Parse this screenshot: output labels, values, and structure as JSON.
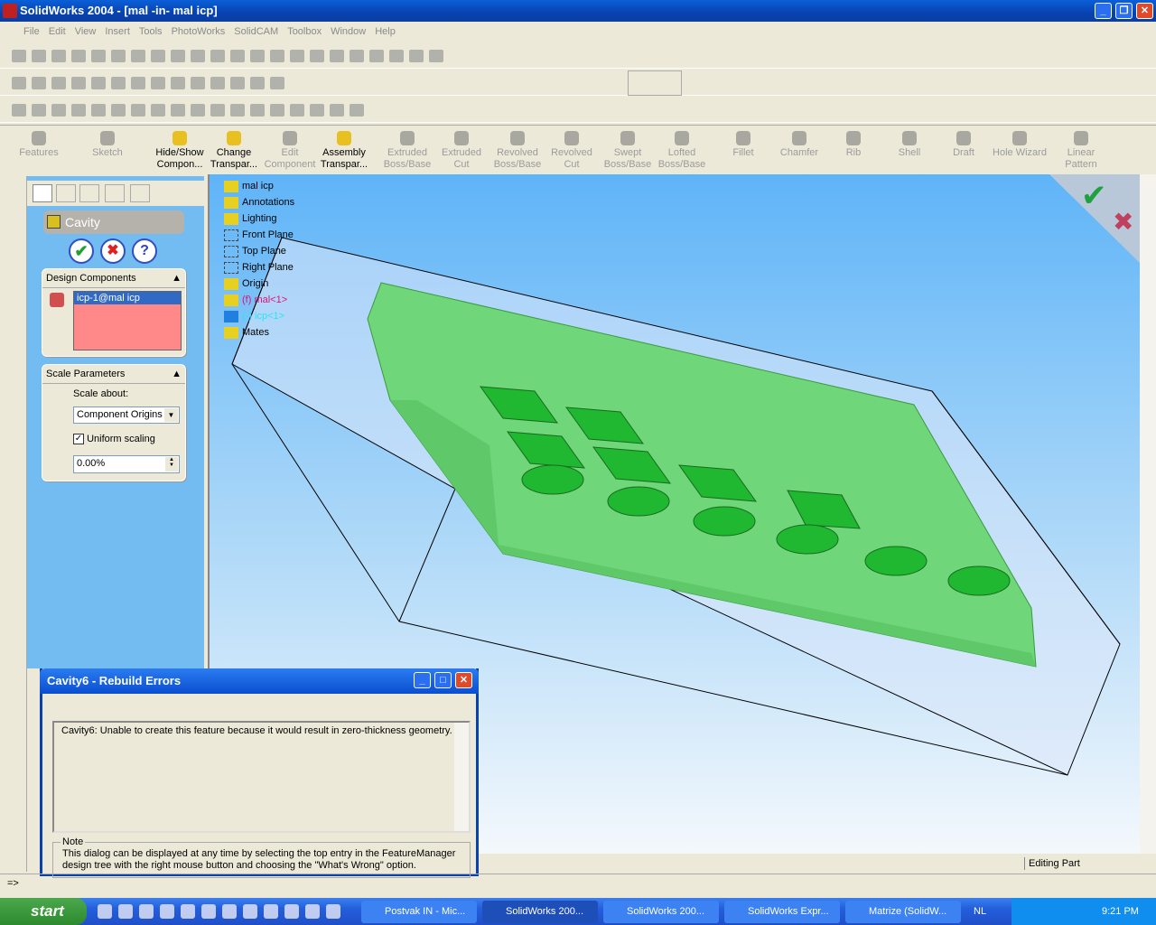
{
  "window": {
    "title": "SolidWorks 2004 - [mal -in- mal icp]"
  },
  "menu": [
    "File",
    "Edit",
    "View",
    "Insert",
    "Tools",
    "PhotoWorks",
    "SolidCAM",
    "Toolbox",
    "Window",
    "Help"
  ],
  "command_manager": [
    {
      "label": "Features",
      "enabled": false
    },
    {
      "label": "Sketch",
      "enabled": false
    },
    {
      "label": "Hide/Show Compon...",
      "enabled": true
    },
    {
      "label": "Change Transpar...",
      "enabled": true
    },
    {
      "label": "Edit Component",
      "enabled": false
    },
    {
      "label": "Assembly Transpar...",
      "enabled": true
    },
    {
      "label": "Extruded Boss/Base",
      "enabled": false
    },
    {
      "label": "Extruded Cut",
      "enabled": false
    },
    {
      "label": "Revolved Boss/Base",
      "enabled": false
    },
    {
      "label": "Revolved Cut",
      "enabled": false
    },
    {
      "label": "Swept Boss/Base",
      "enabled": false
    },
    {
      "label": "Lofted Boss/Base",
      "enabled": false
    },
    {
      "label": "Fillet",
      "enabled": false
    },
    {
      "label": "Chamfer",
      "enabled": false
    },
    {
      "label": "Rib",
      "enabled": false
    },
    {
      "label": "Shell",
      "enabled": false
    },
    {
      "label": "Draft",
      "enabled": false
    },
    {
      "label": "Hole Wizard",
      "enabled": false
    },
    {
      "label": "Linear Pattern",
      "enabled": false
    }
  ],
  "property_manager": {
    "title": "Cavity",
    "design_components": {
      "header": "Design Components",
      "items": [
        "icp-1@mal icp"
      ]
    },
    "scale": {
      "header": "Scale Parameters",
      "scale_about_label": "Scale about:",
      "scale_about_value": "Component Origins",
      "uniform_label": "Uniform scaling",
      "uniform_checked": true,
      "value": "0.00%"
    }
  },
  "tree": [
    {
      "label": "mal icp",
      "color": "#000"
    },
    {
      "label": "Annotations",
      "color": "#000"
    },
    {
      "label": "Lighting",
      "color": "#000"
    },
    {
      "label": "Front Plane",
      "color": "#000"
    },
    {
      "label": "Top Plane",
      "color": "#000"
    },
    {
      "label": "Right Plane",
      "color": "#000"
    },
    {
      "label": "Origin",
      "color": "#000"
    },
    {
      "label": "(f) mal<1>",
      "color": "#e0107a"
    },
    {
      "label": "(-) icp<1>",
      "color": "#20e8f0"
    },
    {
      "label": "Mates",
      "color": "#000"
    }
  ],
  "dialog": {
    "title": "Cavity6 - Rebuild Errors",
    "message": "Cavity6: Unable to create this feature because it would result in zero-thickness geometry.",
    "note_label": "Note",
    "note": "This dialog can be displayed at any time by selecting the top entry in the FeatureManager design tree with the right mouse button and choosing the \"What's Wrong\" option."
  },
  "status": {
    "mode": "Editing Part"
  },
  "command_line": "=>",
  "taskbar": {
    "start": "start",
    "tasks": [
      "Postvak IN - Mic...",
      "SolidWorks 200...",
      "SolidWorks 200...",
      "SolidWorks Expr...",
      "Matrize (SolidW..."
    ],
    "active": 1,
    "language": "NL",
    "clock": "9:21 PM"
  },
  "colors": {
    "part": "#6fd679",
    "pm_bg": "#72bcf2",
    "selected_list": "#ff8888"
  }
}
